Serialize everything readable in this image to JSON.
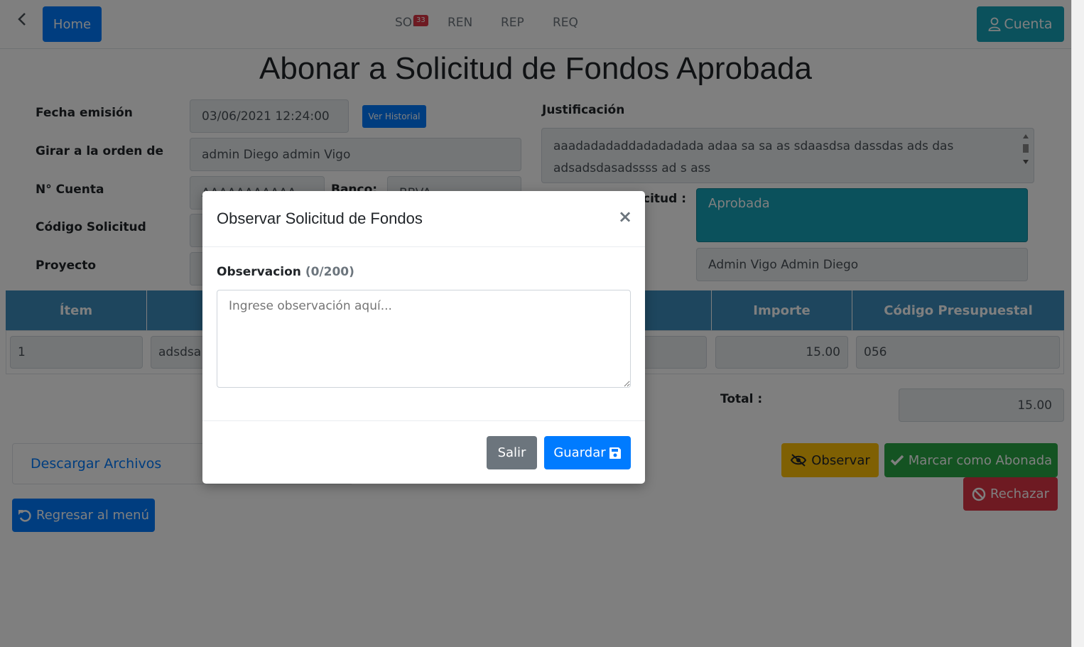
{
  "nav": {
    "home_label": "Home",
    "items": [
      {
        "label": "SOL",
        "badge": "33"
      },
      {
        "label": "REN"
      },
      {
        "label": "REP"
      },
      {
        "label": "REQ"
      }
    ],
    "account_label": "Cuenta"
  },
  "page_title": "Abonar a Solicitud de Fondos Aprobada",
  "form": {
    "fecha_label": "Fecha emisión",
    "fecha_value": "03/06/2021 12:24:00",
    "historial_button": "Ver Historial",
    "girar_label": "Girar a la orden de",
    "girar_value": "admin Diego admin Vigo",
    "cuenta_label": "N° Cuenta",
    "cuenta_value": "AAAAAAAAAAA",
    "banco_label": "Banco:",
    "banco_value": "BBVA",
    "codigo_label": "Código Solicitud",
    "proyecto_label": "Proyecto",
    "justificacion_label": "Justificación",
    "justificacion_value": "aaadadadaddadadadada adaa sa sa as sdaasdsa dassdas ads das adsadsdasadssss ad s ass",
    "estado_label": "citud :",
    "estado_value": "Aprobada",
    "evaluador_value": "Admin Vigo Admin Diego"
  },
  "table": {
    "headers": [
      "Ítem",
      "Importe",
      "Código Presupuestal"
    ],
    "row": {
      "item": "1",
      "concepto": "adsdsa",
      "importe": "15.00",
      "codigo": "056"
    }
  },
  "total": {
    "label": "Total :",
    "value": "15.00"
  },
  "actions": {
    "descargar": "Descargar Archivos",
    "observar": "Observar",
    "abonada": "Marcar como Abonada",
    "rechazar": "Rechazar",
    "regresar": "Regresar al menú"
  },
  "modal": {
    "title": "Observar Solicitud de Fondos",
    "close": "×",
    "field_label": "Observacion",
    "counter": "(0/200)",
    "placeholder": "Ingrese observación aquí...",
    "salir": "Salir",
    "guardar": "Guardar"
  }
}
